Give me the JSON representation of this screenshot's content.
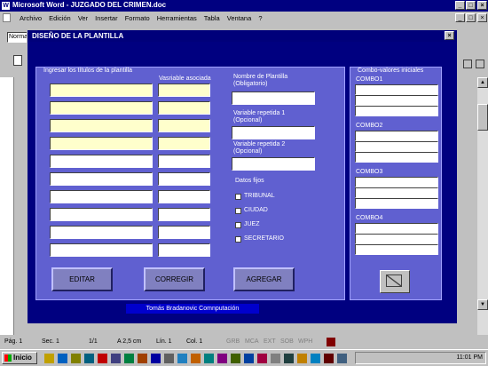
{
  "app": {
    "title": "Microsoft Word - JUZGADO DEL CRIMEN.doc",
    "menu": [
      "Archivo",
      "Edición",
      "Ver",
      "Insertar",
      "Formato",
      "Herramientas",
      "Tabla",
      "Ventana",
      "?"
    ],
    "style_box": "Norma"
  },
  "dialog": {
    "title": "DISEÑO DE LA PLANTILLA",
    "group_titles_label": "Ingresar los títulos de la plantilla",
    "assoc_var_label": "Vasriable asociada",
    "template_name_label": "Nombre de Plantilla",
    "template_name_sub": "(Obligatorio)",
    "rep_var1_label": "Variable repetida 1",
    "rep_var1_sub": "(Opcional)",
    "rep_var2_label": "Variable repetida 2",
    "rep_var2_sub": "(Opcional)",
    "fixed_data_label": "Datos fijos",
    "fixed_items": [
      "TRIBUNAL",
      "CIUDAD",
      "JUEZ",
      "SECRETARIO"
    ],
    "combo_group_label": "Combo-valores iniciales",
    "combo_labels": [
      "COMBO1",
      "COMBO2",
      "COMBO3",
      "COMBO4"
    ],
    "buttons": {
      "edit": "EDITAR",
      "correct": "CORREGIR",
      "add": "AGREGAR"
    },
    "credit": "Tomás Bradanovic Comnputación"
  },
  "statusbar": {
    "page": "Pág. 1",
    "sec": "Sec. 1",
    "pages": "1/1",
    "at": "A 2,5 cm",
    "line": "Lín. 1",
    "col": "Col. 1",
    "modes": [
      "GRB",
      "MCA",
      "EXT",
      "SOB",
      "WPH"
    ]
  },
  "taskbar": {
    "start": "Inicio",
    "clock": "11:01 PM"
  },
  "colors": {
    "dialog_bg": "#000080",
    "panel_bg": "#6060d0",
    "yellow_field": "#ffffcc"
  }
}
